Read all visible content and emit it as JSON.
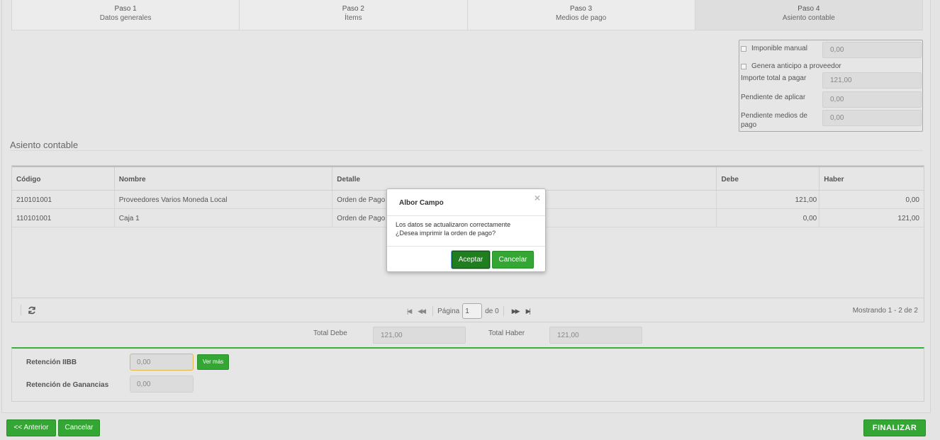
{
  "steps": [
    {
      "num": "Paso 1",
      "name": "Datos generales"
    },
    {
      "num": "Paso 2",
      "name": "Ítems"
    },
    {
      "num": "Paso 3",
      "name": "Medios de pago"
    },
    {
      "num": "Paso 4",
      "name": "Asiento contable"
    }
  ],
  "summary": {
    "imponible_label": "Imponible manual",
    "imponible_value": "0,00",
    "anticipo_label": "Genera anticipo a proveedor",
    "importe_label": "Importe total a pagar",
    "importe_value": "121,00",
    "pendiente_aplicar_label": "Pendiente de aplicar",
    "pendiente_aplicar_value": "0,00",
    "pendiente_medios_label": "Pendiente medios de pago",
    "pendiente_medios_value": "0,00"
  },
  "section_title": "Asiento contable",
  "grid": {
    "headers": [
      "Código",
      "Nombre",
      "Detalle",
      "Debe",
      "Haber"
    ],
    "rows": [
      {
        "codigo": "210101001",
        "nombre": "Proveedores Varios Moneda Local",
        "detalle": "Orden de Pago",
        "debe": "121,00",
        "haber": "0,00"
      },
      {
        "codigo": "110101001",
        "nombre": "Caja 1",
        "detalle": "Orden de Pago",
        "debe": "0,00",
        "haber": "121,00"
      }
    ],
    "pager": {
      "page_label": "Página",
      "page_value": "1",
      "of_label": "de 0",
      "showing": "Mostrando 1 - 2 de 2"
    }
  },
  "totals": {
    "debe_label": "Total Debe",
    "debe_value": "121,00",
    "haber_label": "Total Haber",
    "haber_value": "121,00"
  },
  "retenciones": {
    "iibb_label": "Retención IIBB",
    "iibb_value": "0,00",
    "ver_mas": "Ver más",
    "ganancias_label": "Retención de Ganancias",
    "ganancias_value": "0,00"
  },
  "buttons": {
    "anterior": "<< Anterior",
    "cancelar": "Cancelar",
    "finalizar": "FINALIZAR"
  },
  "modal": {
    "title": "Albor Campo",
    "line1": "Los datos se actualizaron correctamente",
    "line2": "¿Desea imprimir la orden de pago?",
    "accept": "Aceptar",
    "cancel": "Cancelar"
  },
  "colors": {
    "accent_green": "#33a633",
    "dark_green": "#1f7f1f"
  }
}
